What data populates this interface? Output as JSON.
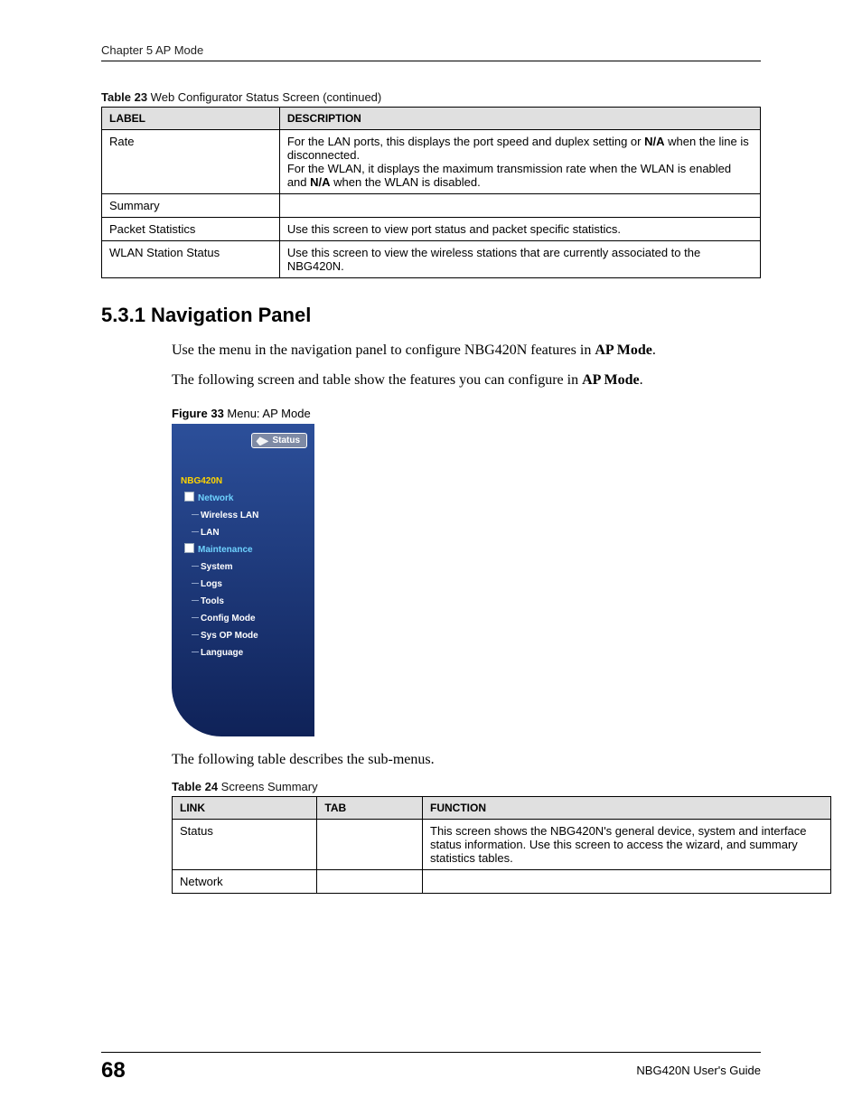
{
  "header": {
    "chapter": "Chapter 5 AP Mode"
  },
  "table23": {
    "caption_bold": "Table 23",
    "caption_rest": "   Web Configurator Status Screen (continued)",
    "col_label": "LABEL",
    "col_desc": "DESCRIPTION",
    "rows": {
      "rate_label": "Rate",
      "rate_desc_line1": "For the LAN ports, this displays the port speed and duplex setting or ",
      "rate_desc_bold1": "N/A",
      "rate_desc_line1b": " when the line is disconnected.",
      "rate_desc_line2": "For the WLAN, it displays the maximum transmission rate when the WLAN is enabled and ",
      "rate_desc_bold2": "N/A",
      "rate_desc_line2b": " when the WLAN is disabled.",
      "summary_label": "Summary",
      "packet_label": "Packet Statistics",
      "packet_desc": "Use this screen to view port status and packet specific statistics.",
      "wlan_label": "WLAN Station Status",
      "wlan_desc": "Use this screen to view the wireless stations that are currently associated to the NBG420N."
    }
  },
  "section": {
    "number": "5.3.1",
    "title": "  Navigation Panel",
    "p1a": "Use the menu in the navigation panel to configure NBG420N features in ",
    "p1b": "AP Mode",
    "p1c": ".",
    "p2a": "The following screen and table show the features you can configure in ",
    "p2b": "AP Mode",
    "p2c": "."
  },
  "figure33": {
    "caption_bold": "Figure 33",
    "caption_rest": "   Menu: AP Mode",
    "status": "Status",
    "root": "NBG420N",
    "cat1": "Network",
    "c1i1": "Wireless LAN",
    "c1i2": "LAN",
    "cat2": "Maintenance",
    "c2i1": "System",
    "c2i2": "Logs",
    "c2i3": "Tools",
    "c2i4": "Config Mode",
    "c2i5": "Sys OP Mode",
    "c2i6": "Language"
  },
  "afterfig": "The following table describes the sub-menus.",
  "table24": {
    "caption_bold": "Table 24",
    "caption_rest": "   Screens Summary",
    "col_link": "LINK",
    "col_tab": "TAB",
    "col_func": "FUNCTION",
    "r1_link": "Status",
    "r1_func": "This screen shows the NBG420N's general device, system and interface status information. Use this screen to access the wizard, and summary statistics tables.",
    "r2_link": "Network"
  },
  "footer": {
    "page": "68",
    "guide": "NBG420N User's Guide"
  }
}
